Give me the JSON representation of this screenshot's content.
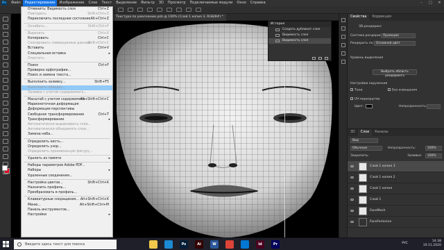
{
  "app": {
    "logo": "Ps"
  },
  "menubar": {
    "items": [
      "Файл",
      "Редактирование",
      "Изображение",
      "Слои",
      "Текст",
      "Выделение",
      "Фильтр",
      "3D",
      "Просмотр",
      "Подключаемые модули",
      "Окно",
      "Справка"
    ],
    "active_index": 1
  },
  "window_controls": [
    "–",
    "□",
    "✕"
  ],
  "document": {
    "tab_title": "Текстура по умолчанию.psb @ 100% (Слой 1 копия 3, RGB/8#) *"
  },
  "edit_menu": {
    "items": [
      {
        "label": "Отменить: Видимость слоя",
        "shortcut": "Ctrl+Z",
        "disabled": false
      },
      {
        "label": "Повторить",
        "shortcut": "Shift+Ctrl+Z",
        "disabled": true
      },
      {
        "label": "Переключить последнее состояние",
        "shortcut": "Alt+Ctrl+Z",
        "disabled": false
      },
      {
        "sep": true
      },
      {
        "label": "Ослабить...",
        "shortcut": "Shift+Ctrl+F",
        "disabled": true
      },
      {
        "sep": true
      },
      {
        "label": "Вырезать",
        "shortcut": "Ctrl+X",
        "disabled": true
      },
      {
        "label": "Копировать",
        "shortcut": "Ctrl+C",
        "disabled": false
      },
      {
        "label": "Скопировать совмещенные данные",
        "shortcut": "Shift+Ctrl+C",
        "disabled": true
      },
      {
        "label": "Вставить",
        "shortcut": "Ctrl+V",
        "disabled": false
      },
      {
        "label": "Специальная вставка",
        "shortcut": "",
        "disabled": false,
        "submenu": true
      },
      {
        "label": "Очистить",
        "shortcut": "",
        "disabled": true
      },
      {
        "sep": true
      },
      {
        "label": "Поиск",
        "shortcut": "Ctrl+F",
        "disabled": false
      },
      {
        "label": "Проверка орфографии...",
        "shortcut": "",
        "disabled": false
      },
      {
        "label": "Поиск и замена текста...",
        "shortcut": "",
        "disabled": false
      },
      {
        "sep": true
      },
      {
        "label": "Выполнить заливку...",
        "shortcut": "Shift+F5",
        "disabled": false
      },
      {
        "label": "Выполнить обводку...",
        "shortcut": "",
        "disabled": true,
        "highlight": true
      },
      {
        "label": "Заливка с учетом содержимого...",
        "shortcut": "",
        "disabled": true
      },
      {
        "sep": true
      },
      {
        "label": "Масштаб с учетом содержимого",
        "shortcut": "Alt+Shift+Ctrl+C",
        "disabled": false
      },
      {
        "label": "Марионеточная деформация",
        "shortcut": "",
        "disabled": false
      },
      {
        "label": "Деформация перспективы",
        "shortcut": "",
        "disabled": false
      },
      {
        "label": "Свободное трансформирование",
        "shortcut": "Ctrl+T",
        "disabled": false
      },
      {
        "label": "Трансформирование",
        "shortcut": "",
        "disabled": false,
        "submenu": true
      },
      {
        "label": "Автоматически выравнивать слои...",
        "shortcut": "",
        "disabled": true
      },
      {
        "label": "Автоматически объединять слои...",
        "shortcut": "",
        "disabled": true
      },
      {
        "label": "Замена неба...",
        "shortcut": "",
        "disabled": false
      },
      {
        "sep": true
      },
      {
        "label": "Определить кисть...",
        "shortcut": "",
        "disabled": false
      },
      {
        "label": "Определить узор...",
        "shortcut": "",
        "disabled": false
      },
      {
        "label": "Определить произвольную фигуру...",
        "shortcut": "",
        "disabled": true
      },
      {
        "sep": true
      },
      {
        "label": "Удалить из памяти",
        "shortcut": "",
        "disabled": false,
        "submenu": true
      },
      {
        "sep": true
      },
      {
        "label": "Наборы параметров Adobe PDF...",
        "shortcut": "",
        "disabled": false
      },
      {
        "label": "Наборы",
        "shortcut": "",
        "disabled": false,
        "submenu": true
      },
      {
        "label": "Удаленные соединения...",
        "shortcut": "",
        "disabled": false
      },
      {
        "sep": true
      },
      {
        "label": "Настройка цветов...",
        "shortcut": "Shift+Ctrl+K",
        "disabled": false
      },
      {
        "label": "Назначить профиль...",
        "shortcut": "",
        "disabled": false
      },
      {
        "label": "Преобразовать в профиль...",
        "shortcut": "",
        "disabled": false
      },
      {
        "sep": true
      },
      {
        "label": "Клавиатурные сокращения...",
        "shortcut": "Alt+Shift+Ctrl+K",
        "disabled": false
      },
      {
        "label": "Меню...",
        "shortcut": "Alt+Shift+Ctrl+M",
        "disabled": false
      },
      {
        "label": "Панель инструментов...",
        "shortcut": "",
        "disabled": false
      },
      {
        "label": "Настройки",
        "shortcut": "",
        "disabled": false,
        "submenu": true
      }
    ]
  },
  "history": {
    "title": "История",
    "rows": [
      "Создать дубликат слоя",
      "Видимость слоя",
      "Видимость слоя"
    ],
    "selected_index": 2
  },
  "properties": {
    "tabs": [
      "Свойства",
      "Коррекция"
    ],
    "label_3d_render": "3D-рендеринг",
    "render_system_label": "Система рендеринга:",
    "render_system_value": "Проекция",
    "render_for_label": "Рендерить по:",
    "render_for_value": "Основной цвет",
    "quality_label": "Уровень выделения",
    "btn_render_selection": "Выбрать область рендеринга",
    "env_settings": "Настройки окружения",
    "shadow_label": "Тени",
    "no_shadow_label": "Без освещения",
    "uv_overlay": "UV-перекрытие",
    "color_label": "Цвет:",
    "opacity_label": "Непрозрачность:"
  },
  "layers": {
    "tabs": [
      "3D",
      "Слои",
      "Каналы"
    ],
    "kind_label": "Вид",
    "blend_mode": "Обычные",
    "opacity_label": "Непрозрачность:",
    "opacity_value": "100%",
    "lock_label": "Закрепить:",
    "fill_label": "Заливка:",
    "fill_value": "100%",
    "rows": [
      {
        "name": "Слой 1 копия 3",
        "selected": true,
        "dark": false
      },
      {
        "name": "Слой 1 копия 2",
        "selected": false,
        "dark": false
      },
      {
        "name": "Слой 1 копия",
        "selected": false,
        "dark": false
      },
      {
        "name": "Слой 1",
        "selected": false,
        "dark": false
      },
      {
        "name": "FaceMesh",
        "selected": false,
        "dark": false
      },
      {
        "name": "FaceFeminine",
        "selected": false,
        "dark": true
      }
    ]
  },
  "taskbar": {
    "search_placeholder": "Введите здесь текст для поиска",
    "apps": [
      {
        "name": "explorer-icon",
        "color": "#f2c84b",
        "label": ""
      },
      {
        "name": "edge-icon",
        "color": "#1b8ad3",
        "label": ""
      },
      {
        "name": "photoshop-icon",
        "color": "#001e36",
        "label": "Ps"
      },
      {
        "name": "illustrator-icon",
        "color": "#330000",
        "label": "Ai"
      },
      {
        "name": "word-icon",
        "color": "#2b579a",
        "label": "W"
      },
      {
        "name": "chrome-icon",
        "color": "#db4437",
        "label": ""
      },
      {
        "name": "mail-icon",
        "color": "#0078d4",
        "label": ""
      },
      {
        "name": "indesign-icon",
        "color": "#49021f",
        "label": "Id"
      },
      {
        "name": "premiere-icon",
        "color": "#00005b",
        "label": "Pr"
      }
    ],
    "lang": "РУС",
    "time": "14:38",
    "date": "19.11.2020"
  },
  "colors": {
    "accent": "#1473e6",
    "foreground_swatch": "#ffffff",
    "background_swatch": "#e1001a"
  }
}
